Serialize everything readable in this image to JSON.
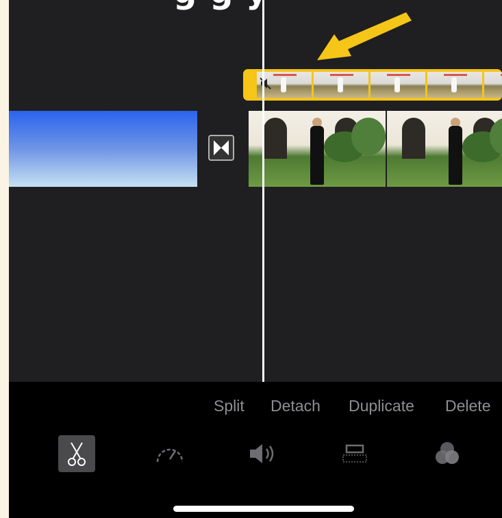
{
  "heading": {
    "text": "g   g   y"
  },
  "colors": {
    "accent": "#f5c518",
    "playhead": "#ffffff",
    "action_text": "#8e8e93"
  },
  "timeline": {
    "overlay_clip": {
      "state": "selected",
      "muted": true,
      "icon": "speaker-muted-icon"
    },
    "transition": {
      "icon": "transition-bowtie-icon"
    },
    "clips": [
      "blue-gradient-clip",
      "garden-video-clip"
    ]
  },
  "toolbar": {
    "actions": {
      "split": "Split",
      "detach": "Detach",
      "duplicate": "Duplicate",
      "delete": "Delete"
    },
    "tools": [
      {
        "name": "scissors-icon",
        "selected": true
      },
      {
        "name": "speedometer-icon",
        "selected": false
      },
      {
        "name": "volume-icon",
        "selected": false
      },
      {
        "name": "title-overlay-icon",
        "selected": false
      },
      {
        "name": "filters-icon",
        "selected": false
      }
    ]
  }
}
